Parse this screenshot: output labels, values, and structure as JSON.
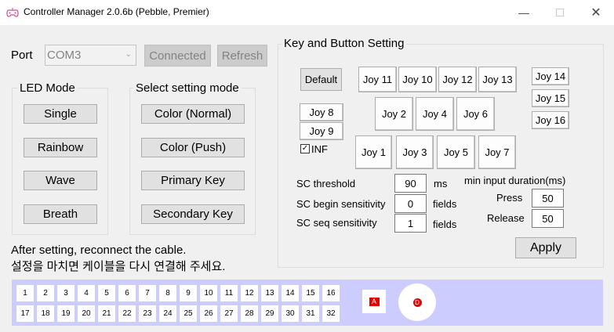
{
  "window": {
    "title": "Controller Manager 2.0.6b (Pebble, Premier)"
  },
  "icons": {
    "app": "gamepad-icon",
    "minimize": "minimize-icon",
    "maximize": "maximize-icon",
    "close": "close-icon"
  },
  "port": {
    "label": "Port",
    "value": "COM3",
    "connected_label": "Connected",
    "refresh_label": "Refresh"
  },
  "led_mode": {
    "title": "LED Mode",
    "buttons": [
      "Single",
      "Rainbow",
      "Wave",
      "Breath"
    ]
  },
  "setting_mode": {
    "title": "Select setting mode",
    "buttons": [
      "Color (Normal)",
      "Color (Push)",
      "Primary Key",
      "Secondary Key"
    ]
  },
  "notice": {
    "en": "After setting, reconnect the cable.",
    "ko": "설정을 마치면 케이블을 다시 연결해 주세요."
  },
  "key_setting": {
    "title": "Key and Button Setting",
    "default_label": "Default",
    "top_row": [
      "Joy 11",
      "Joy 10",
      "Joy 12",
      "Joy 13"
    ],
    "right_col": [
      "Joy 14",
      "Joy 15",
      "Joy 16"
    ],
    "left_col": [
      "Joy 8",
      "Joy 9"
    ],
    "mid_row": [
      "Joy 2",
      "Joy 4",
      "Joy 6"
    ],
    "bottom_row": [
      "Joy 1",
      "Joy 3",
      "Joy 5",
      "Joy 7"
    ],
    "inf_label": "INF",
    "inf_checked": true,
    "sc_threshold": {
      "label": "SC threshold",
      "value": "90",
      "unit": "ms"
    },
    "sc_begin": {
      "label": "SC begin sensitivity",
      "value": "0",
      "unit": "fields"
    },
    "sc_seq": {
      "label": "SC seq sensitivity",
      "value": "1",
      "unit": "fields"
    },
    "min_input": {
      "title": "min input duration(ms)",
      "press_label": "Press",
      "press_value": "50",
      "release_label": "Release",
      "release_value": "50"
    },
    "apply_label": "Apply"
  },
  "indicator": {
    "row1": [
      "1",
      "2",
      "3",
      "4",
      "5",
      "6",
      "7",
      "8",
      "9",
      "10",
      "11",
      "12",
      "13",
      "14",
      "15",
      "16"
    ],
    "row2": [
      "17",
      "18",
      "19",
      "20",
      "21",
      "22",
      "23",
      "24",
      "25",
      "26",
      "27",
      "28",
      "29",
      "30",
      "31",
      "32"
    ],
    "marker_a": "A",
    "marker_d": "D",
    "accent_color": "#e60000",
    "panel_color": "#ccccff"
  }
}
